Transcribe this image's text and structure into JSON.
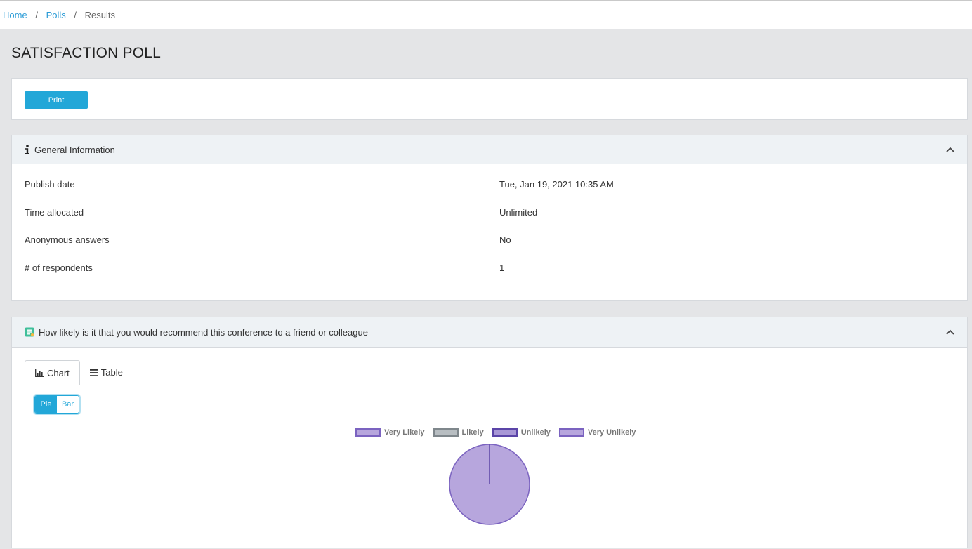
{
  "breadcrumb": {
    "items": [
      {
        "label": "Home"
      },
      {
        "label": "Polls"
      }
    ],
    "current": "Results",
    "separator": "/"
  },
  "page": {
    "title": "SATISFACTION POLL"
  },
  "toolbar": {
    "print_label": "Print"
  },
  "general_info": {
    "title": "General Information",
    "rows": [
      {
        "label": "Publish date",
        "value": "Tue, Jan 19, 2021 10:35 AM"
      },
      {
        "label": "Time allocated",
        "value": "Unlimited"
      },
      {
        "label": "Anonymous answers",
        "value": "No"
      },
      {
        "label": "# of respondents",
        "value": "1"
      }
    ]
  },
  "question": {
    "title": "How likely is it that you would recommend this conference to a friend or colleague",
    "tabs": [
      {
        "label": "Chart",
        "active": true
      },
      {
        "label": "Table",
        "active": false
      }
    ],
    "chart_type_toggle": [
      {
        "label": "Pie",
        "active": true
      },
      {
        "label": "Bar",
        "active": false
      }
    ]
  },
  "colors": {
    "accent": "#22a7d8",
    "link": "#2a9bd6",
    "pie_fill": "#b7a6dd",
    "pie_stroke": "#6a55b0"
  },
  "chart_data": {
    "type": "pie",
    "legend_position": "top",
    "categories": [
      "Very Likely",
      "Likely",
      "Unlikely",
      "Very Unlikely"
    ],
    "values": [
      1,
      0,
      0,
      0
    ],
    "series_colors": [
      {
        "fill": "#b7a6dd",
        "stroke": "#7b63c0"
      },
      {
        "fill": "#b8bec2",
        "stroke": "#7f878c"
      },
      {
        "fill": "#a897d6",
        "stroke": "#5b45a8"
      },
      {
        "fill": "#b7a6dd",
        "stroke": "#7b63c0"
      }
    ]
  }
}
